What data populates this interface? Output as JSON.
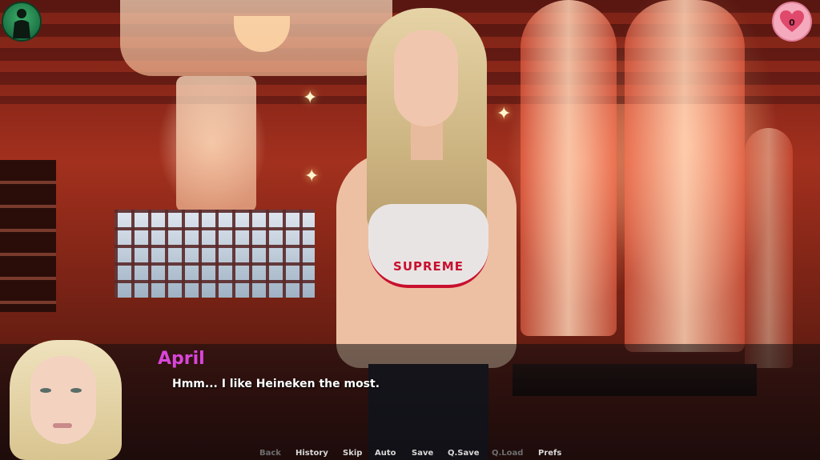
{
  "hud": {
    "affection_count": "0"
  },
  "scene": {
    "shirt_text": "SUPREME"
  },
  "dialogue": {
    "speaker": "April",
    "text": "Hmm... I like Heineken the most."
  },
  "quick_menu": [
    {
      "label": "Back",
      "enabled": false
    },
    {
      "label": "History",
      "enabled": true
    },
    {
      "label": "Skip",
      "enabled": true
    },
    {
      "label": "Auto",
      "enabled": true
    },
    {
      "label": "Save",
      "enabled": true
    },
    {
      "label": "Q.Save",
      "enabled": true
    },
    {
      "label": "Q.Load",
      "enabled": false
    },
    {
      "label": "Prefs",
      "enabled": true
    }
  ],
  "colors": {
    "speaker_name": "#d946d9",
    "quick_menu_enabled": "#d8d8d8",
    "quick_menu_disabled": "#6e6e6e",
    "heart_button": "#f4a9bc"
  },
  "icons": {
    "top_left": "person-silhouette-icon",
    "top_right": "heart-icon"
  }
}
